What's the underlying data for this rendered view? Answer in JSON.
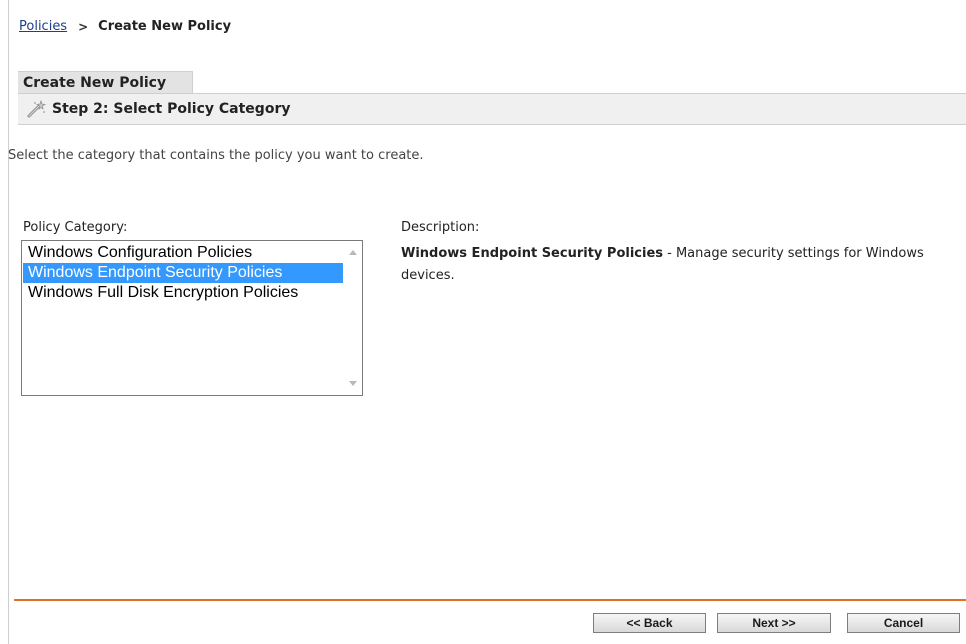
{
  "breadcrumb": {
    "parent_label": "Policies",
    "separator": ">",
    "current_label": "Create New Policy"
  },
  "tab": {
    "label": "Create New Policy"
  },
  "step": {
    "title": "Step 2: Select Policy Category",
    "icon": "magic-wand-icon"
  },
  "instruction": "Select the category that contains the policy you want to create.",
  "category": {
    "label": "Policy Category:",
    "items": [
      {
        "label": "Windows Configuration Policies",
        "selected": false
      },
      {
        "label": "Windows Endpoint Security Policies",
        "selected": true
      },
      {
        "label": "Windows Full Disk Encryption Policies",
        "selected": false
      }
    ]
  },
  "description": {
    "label": "Description:",
    "title": "Windows Endpoint Security Policies",
    "text": " - Manage security settings for Windows devices."
  },
  "buttons": {
    "back": "<< Back",
    "next": "Next >>",
    "cancel": "Cancel"
  },
  "colors": {
    "divider": "#e07028",
    "selection": "#3399ff",
    "link": "#1e3e8c"
  }
}
